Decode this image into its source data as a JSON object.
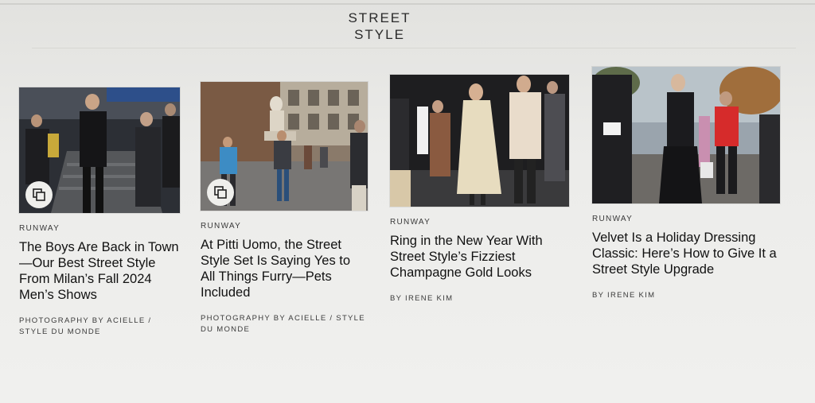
{
  "section": {
    "title_line1": "STREET",
    "title_line2": "STYLE"
  },
  "cards": [
    {
      "kicker": "RUNWAY",
      "headline": "The Boys Are Back in Town—Our Best Street Style From Milan’s Fall 2024 Men’s Shows",
      "byline": "PHOTOGRAPHY BY ACIELLE / STYLE DU MONDE",
      "has_gallery_icon": true
    },
    {
      "kicker": "RUNWAY",
      "headline": "At Pitti Uomo, the Street Style Set Is Saying Yes to All Things Furry—Pets Included",
      "byline": "PHOTOGRAPHY BY ACIELLE / STYLE DU MONDE",
      "has_gallery_icon": true
    },
    {
      "kicker": "RUNWAY",
      "headline": "Ring in the New Year With Street Style’s Fizziest Champagne Gold Looks",
      "byline": "BY IRENE KIM",
      "has_gallery_icon": false
    },
    {
      "kicker": "RUNWAY",
      "headline": "Velvet Is a Holiday Dressing Classic: Here’s How to Give It a Street Style Upgrade",
      "byline": "BY IRENE KIM",
      "has_gallery_icon": false
    }
  ],
  "icons": {
    "gallery": "gallery-stack-icon"
  }
}
